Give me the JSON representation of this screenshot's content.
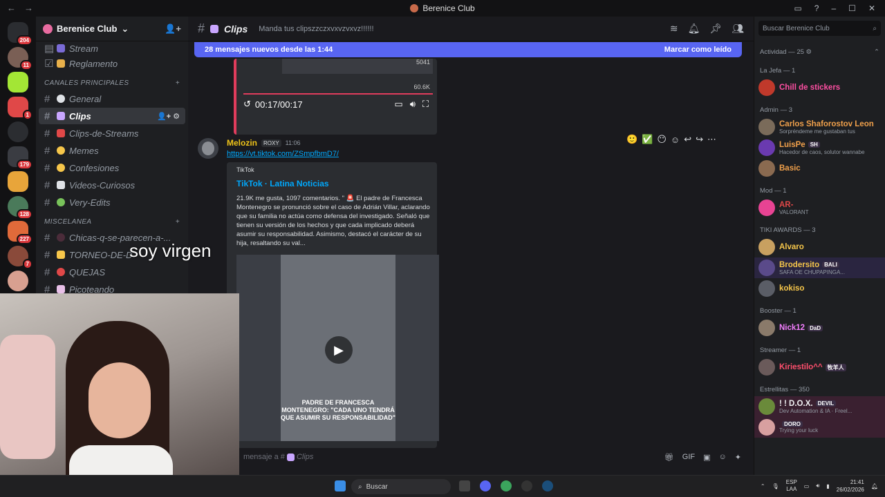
{
  "window": {
    "title": "Berenice Club",
    "back": "←",
    "forward": "→"
  },
  "server": {
    "name": "Berenice Club"
  },
  "server_badges": [
    "204",
    "11",
    "1",
    "179",
    "128",
    "227",
    "7"
  ],
  "channels": {
    "top": [
      {
        "name": "Stream",
        "emoji_color": "#7a6bd6"
      },
      {
        "name": "Reglamento",
        "emoji_color": "#e8b04a"
      }
    ],
    "cat_main": "CANALES PRINCIPALES",
    "main": [
      {
        "name": "General",
        "emoji_color": "#dfe2e6"
      },
      {
        "name": "Clips",
        "emoji_color": "#c9a6ff"
      },
      {
        "name": "Clips-de-Streams",
        "emoji_color": "#e04848"
      },
      {
        "name": "Memes",
        "emoji_color": "#f6c64a"
      },
      {
        "name": "Confesiones",
        "emoji_color": "#f6c64a"
      },
      {
        "name": "Videos-Curiosos",
        "emoji_color": "#dfe2e6"
      },
      {
        "name": "Very-Edits",
        "emoji_color": "#78c25a"
      }
    ],
    "cat_misc": "MISCELANEA",
    "misc": [
      {
        "name": "Chicas-q-se-parecen-a-...",
        "emoji_color": "#4b2c3a"
      },
      {
        "name": "TORNEO-DE-D",
        "emoji_color": "#f6c64a"
      },
      {
        "name": "QUEJAS",
        "emoji_color": "#e04848"
      },
      {
        "name": "Picoteando",
        "emoji_color": "#e8c0e8"
      }
    ]
  },
  "header": {
    "channel": "Clips",
    "topic": "Manda tus clipszzczxvxvzvxvz!!!!!!"
  },
  "banner": {
    "text": "28 mensajes nuevos desde las 1:44",
    "action": "Marcar como leído"
  },
  "old_video": {
    "time": "00:17/00:17",
    "count_top": "5041",
    "count_bottom": "60.6K"
  },
  "message": {
    "author": "Melozin",
    "tag": "ROXY",
    "time": "11:06",
    "link": "https://vt.tiktok.com/ZSmpfbmD7/",
    "embed": {
      "provider": "TikTok",
      "title": "TikTok · Latina Noticias",
      "description": "21.9K me gusta, 1097 comentarios. \" 🚨 El padre de Francesca Montenegro se pronunció sobre el caso de Adrián Villar, aclarando que su familia no actúa como defensa del investigado. Señaló que tienen su versión de los hechos y que cada implicado deberá asumir su responsabilidad. Asimismo, destacó el carácter de su hija, resaltando su val...",
      "caption": "PADRE DE FRANCESCA MONTENEGRO: \"CADA UNO TENDRÁ QUE ASUMIR SU RESPONSABILIDAD\""
    }
  },
  "composer": {
    "placeholder": "mensaje a #",
    "channel": "Clips"
  },
  "members": {
    "search": "Buscar Berenice Club",
    "activity": "Actividad — 25",
    "groups": [
      {
        "title": "La Jefa",
        "count": "— 1",
        "items": [
          {
            "name": "Chill de stickers",
            "status": "",
            "badge": "",
            "color": "#ff4fa3"
          }
        ]
      },
      {
        "title": "Admin — 3",
        "count": "",
        "items": [
          {
            "name": "Carlos Shaforostov Leon",
            "status": "Sorpréndeme me gustaban tus",
            "badge": "",
            "color": "#f0a04b"
          },
          {
            "name": "LuisPe",
            "status": "Hacedor de caos, solutor wannabe",
            "badge": "SH",
            "color": "#f0a04b"
          },
          {
            "name": "Basic",
            "status": "",
            "badge": "",
            "color": "#f0a04b"
          }
        ]
      },
      {
        "title": "Mod — 1",
        "count": "",
        "items": [
          {
            "name": "AR-",
            "status": "VALORANT",
            "badge": "",
            "color": "#e04848"
          }
        ]
      },
      {
        "title": "TIKI AWARDS — 3",
        "count": "",
        "items": [
          {
            "name": "Alvaro",
            "status": "",
            "badge": "",
            "color": "#f6c64a"
          },
          {
            "name": "Brodersito",
            "status": "SAFA OE CHUPAPINGA...",
            "badge": "BALI",
            "color": "#f6c64a"
          },
          {
            "name": "kokiso",
            "status": "",
            "badge": "",
            "color": "#f6c64a"
          }
        ]
      },
      {
        "title": "Booster — 1",
        "count": "",
        "items": [
          {
            "name": "Nick12",
            "status": "",
            "badge": "DaD",
            "color": "#f47fff"
          }
        ]
      },
      {
        "title": "Streamer — 1",
        "count": "",
        "items": [
          {
            "name": "Kiriestilo^^",
            "status": "",
            "badge": "牧羊人",
            "color": "#ff4f6d"
          }
        ]
      },
      {
        "title": "Estrellitas — 350",
        "count": "",
        "items": [
          {
            "name": "! ! D.O.X.",
            "status": "Dev Automation & IA · Freel...",
            "badge": "DEVIL",
            "color": "#f2f3f5"
          },
          {
            "name": "",
            "status": "Trying your luck",
            "badge": "DORO",
            "color": "#f2f3f5"
          }
        ]
      }
    ]
  },
  "overlay_text": "soy virgen",
  "taskbar": {
    "search": "Buscar",
    "lang1": "ESP",
    "lang2": "LAA",
    "time": "21:41",
    "date": "26/02/2026"
  }
}
